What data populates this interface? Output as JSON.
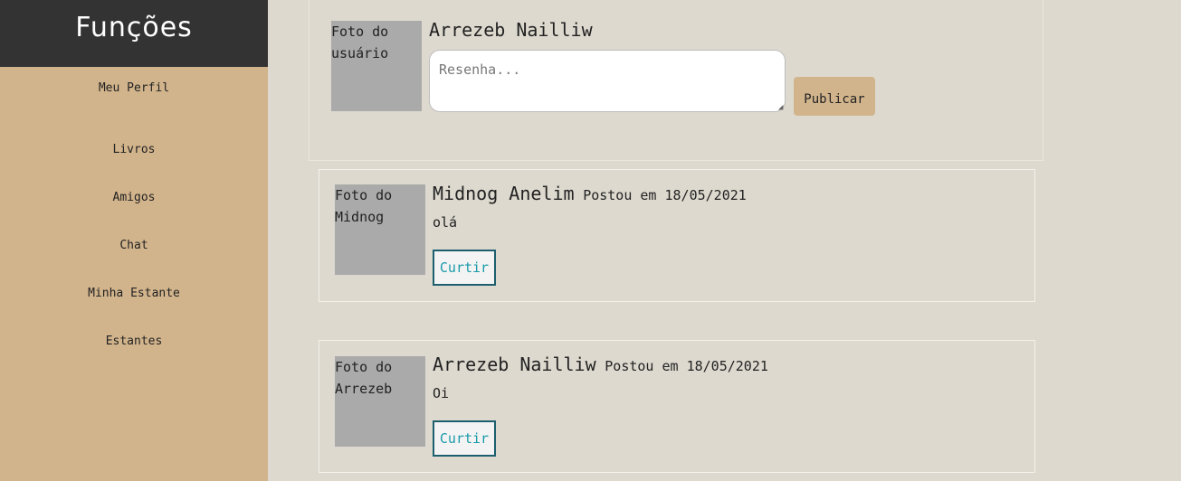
{
  "sidebar": {
    "title": "Funções",
    "items": [
      {
        "label": "Meu Perfil"
      },
      {
        "label": "Livros"
      },
      {
        "label": "Amigos"
      },
      {
        "label": "Chat"
      },
      {
        "label": "Minha Estante"
      },
      {
        "label": "Estantes"
      }
    ]
  },
  "composer": {
    "photo_alt": "Foto do\nusuário",
    "user_name": "Arrezeb Nailliw",
    "placeholder": "Resenha...",
    "publish_label": "Publicar"
  },
  "posts": [
    {
      "photo_alt": "Foto do\nMidnog",
      "author": "Midnog Anelim",
      "date_text": "Postou em 18/05/2021",
      "text": "olá",
      "like_label": "Curtir"
    },
    {
      "photo_alt": "Foto do\nArrezeb",
      "author": "Arrezeb Nailliw",
      "date_text": "Postou em 18/05/2021",
      "text": "Oi",
      "like_label": "Curtir"
    }
  ],
  "colors": {
    "sidebar_bg": "#d2b48c",
    "header_bg": "#333333",
    "page_bg": "#ddd9cf",
    "photo_bg": "#aaaaaa",
    "like_text": "#1b9aaa"
  }
}
